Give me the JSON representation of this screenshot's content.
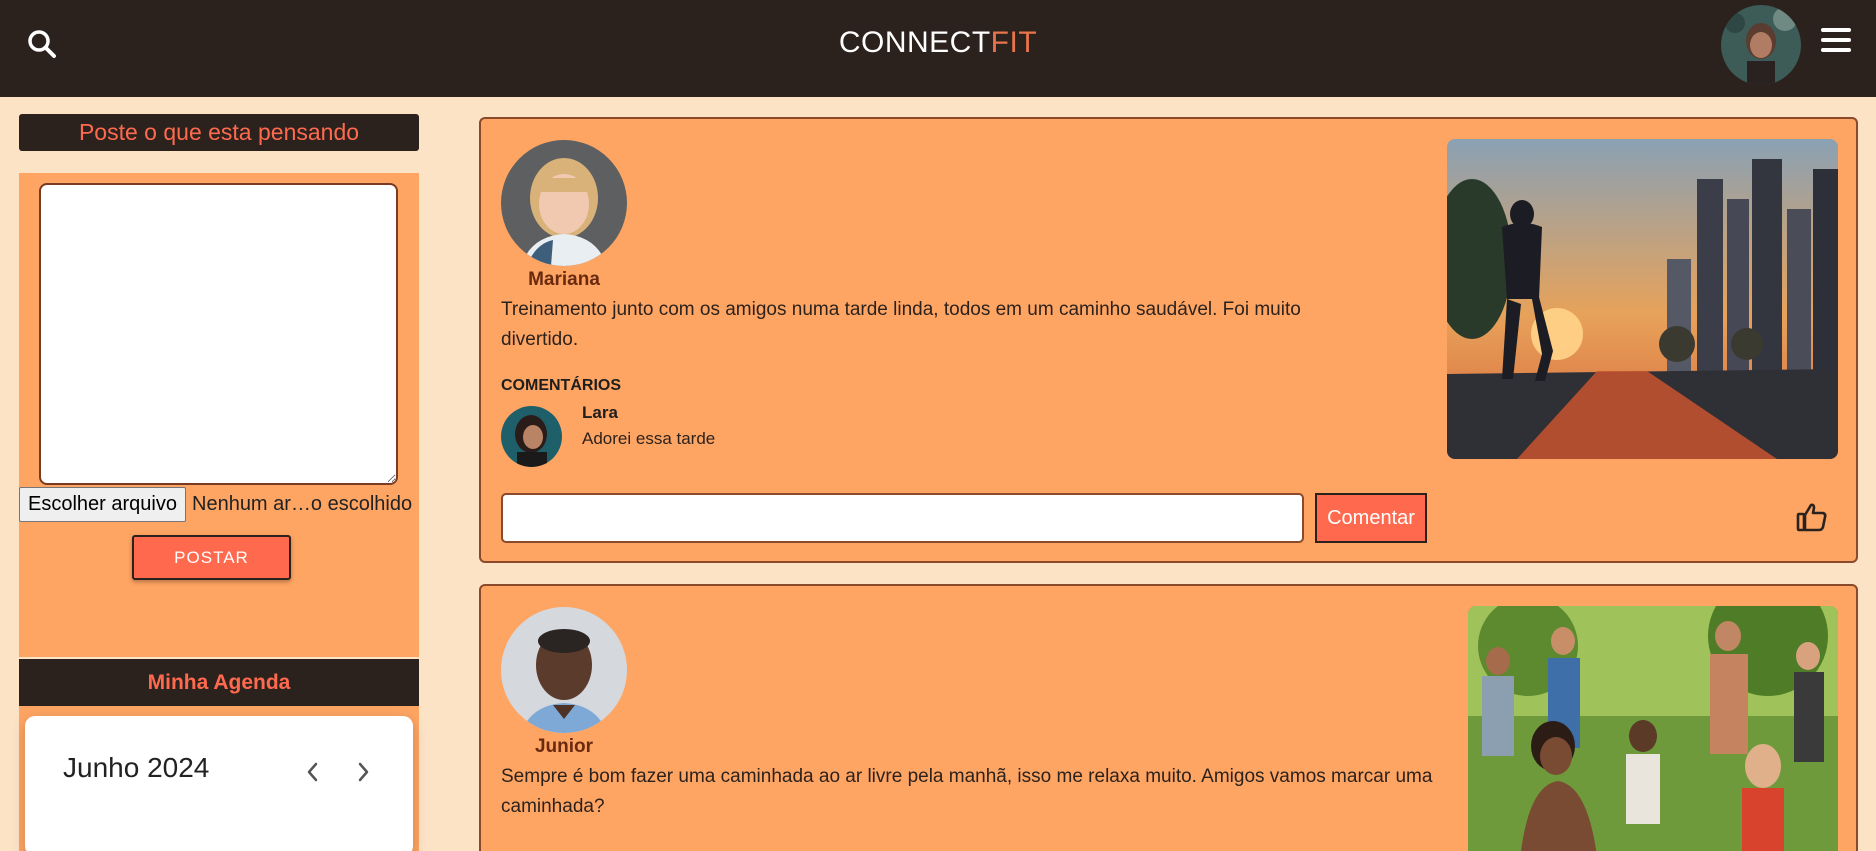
{
  "header": {
    "logo_main": "CONNECT",
    "logo_accent": "FIT",
    "search_icon": "search-icon",
    "menu_icon": "hamburger-menu-icon"
  },
  "sidebar": {
    "post_prompt": "Poste o que esta pensando",
    "file_button_label": "Escolher arquivo",
    "file_status": "Nenhum ar…o escolhido",
    "post_button_label": "POSTAR",
    "agenda_title": "Minha Agenda",
    "calendar": {
      "month_label": "Junho 2024",
      "prev_icon": "chevron-left-icon",
      "next_icon": "chevron-right-icon"
    }
  },
  "feed": {
    "posts": [
      {
        "author": "Mariana",
        "text": "Treinamento junto com os amigos numa tarde linda, todos em um caminho saudável. Foi muito divertido.",
        "comments_title": "COMENTÁRIOS",
        "comments": [
          {
            "author": "Lara",
            "text": "Adorei essa tarde"
          }
        ],
        "comment_button_label": "Comentar",
        "like_icon": "thumbs-up-icon"
      },
      {
        "author": "Junior",
        "text": "Sempre é bom fazer uma caminhada ao ar livre pela manhã, isso me relaxa muito. Amigos vamos marcar uma caminhada?"
      }
    ]
  },
  "colors": {
    "header_bg": "#2c221d",
    "page_bg": "#fde3c6",
    "card_bg": "#ffa563",
    "accent": "#ff6a4f",
    "logo_accent": "#e8744c"
  }
}
